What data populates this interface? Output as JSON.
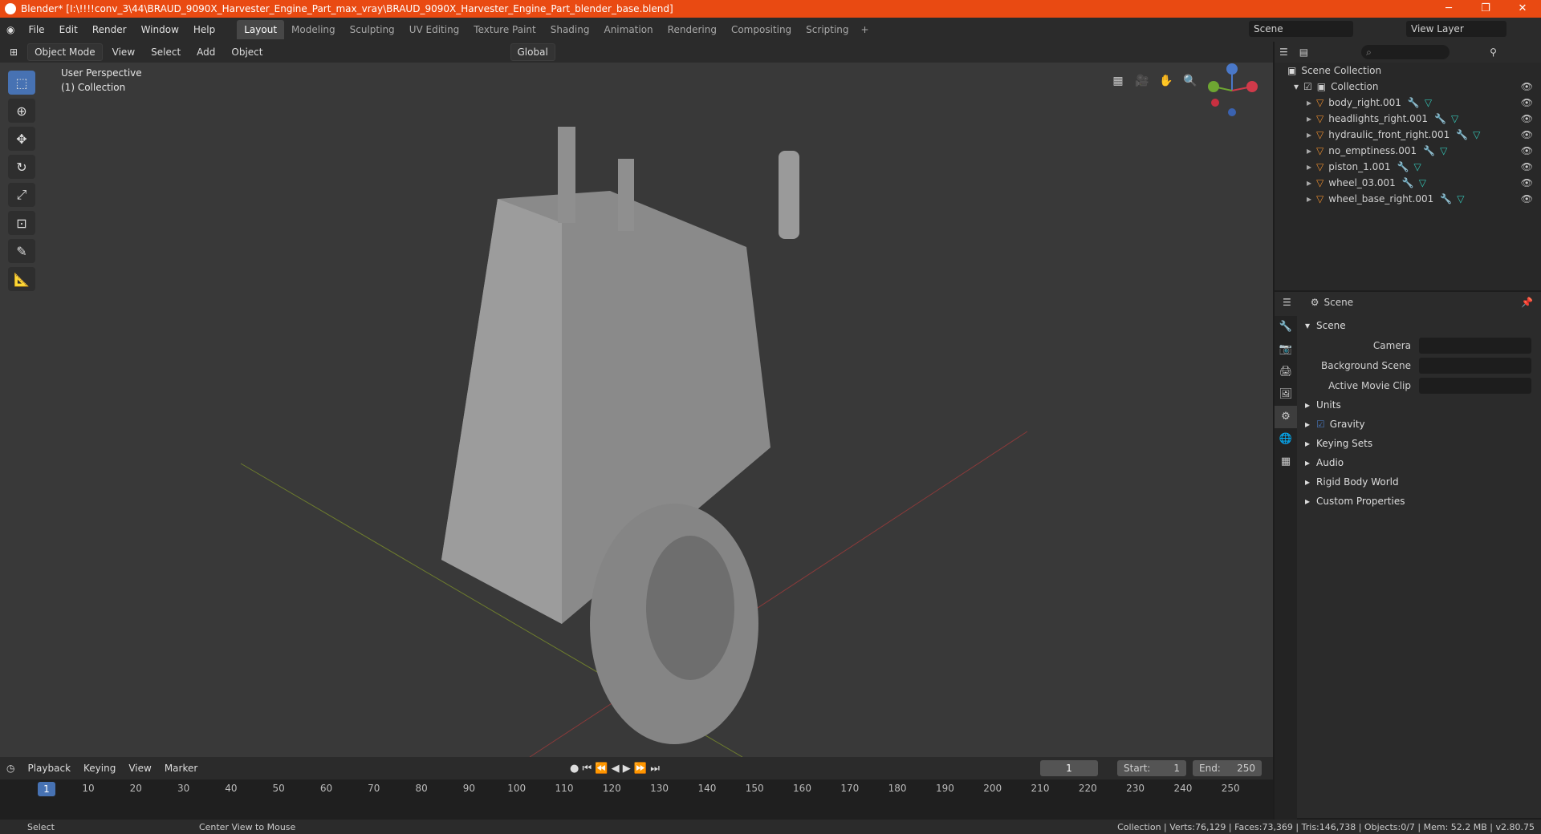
{
  "title": "Blender* [I:\\!!!!conv_3\\44\\BRAUD_9090X_Harvester_Engine_Part_max_vray\\BRAUD_9090X_Harvester_Engine_Part_blender_base.blend]",
  "menu": [
    "File",
    "Edit",
    "Render",
    "Window",
    "Help"
  ],
  "workspaces": [
    "Layout",
    "Modeling",
    "Sculpting",
    "UV Editing",
    "Texture Paint",
    "Shading",
    "Animation",
    "Rendering",
    "Compositing",
    "Scripting"
  ],
  "scene_name": "Scene",
  "view_layer": "View Layer",
  "viewport_header": {
    "mode": "Object Mode",
    "view": "View",
    "select": "Select",
    "add": "Add",
    "object": "Object",
    "orientation": "Global"
  },
  "viewport": {
    "perspective": "User Perspective",
    "collection": "(1) Collection"
  },
  "outliner": {
    "root": "Scene Collection",
    "collection": "Collection",
    "objects": [
      "body_right.001",
      "headlights_right.001",
      "hydraulic_front_right.001",
      "no_emptiness.001",
      "piston_1.001",
      "wheel_03.001",
      "wheel_base_right.001"
    ]
  },
  "properties": {
    "header": "Scene",
    "panel": "Scene",
    "camera_label": "Camera",
    "bg_scene_label": "Background Scene",
    "movie_clip_label": "Active Movie Clip",
    "sections": [
      "Units",
      "Gravity",
      "Keying Sets",
      "Audio",
      "Rigid Body World",
      "Custom Properties"
    ]
  },
  "timeline": {
    "playback": "Playback",
    "keying": "Keying",
    "view": "View",
    "marker": "Marker",
    "current": "1",
    "start_label": "Start:",
    "start": "1",
    "end_label": "End:",
    "end": "250",
    "ticks": [
      "10",
      "20",
      "30",
      "40",
      "50",
      "60",
      "70",
      "80",
      "90",
      "100",
      "110",
      "120",
      "130",
      "140",
      "150",
      "160",
      "170",
      "180",
      "190",
      "200",
      "210",
      "220",
      "230",
      "240",
      "250"
    ]
  },
  "status": {
    "left": "Select",
    "mid": "Center View to Mouse",
    "right": "Collection | Verts:76,129 | Faces:73,369 | Tris:146,738 | Objects:0/7 | Mem: 52.2 MB | v2.80.75"
  }
}
